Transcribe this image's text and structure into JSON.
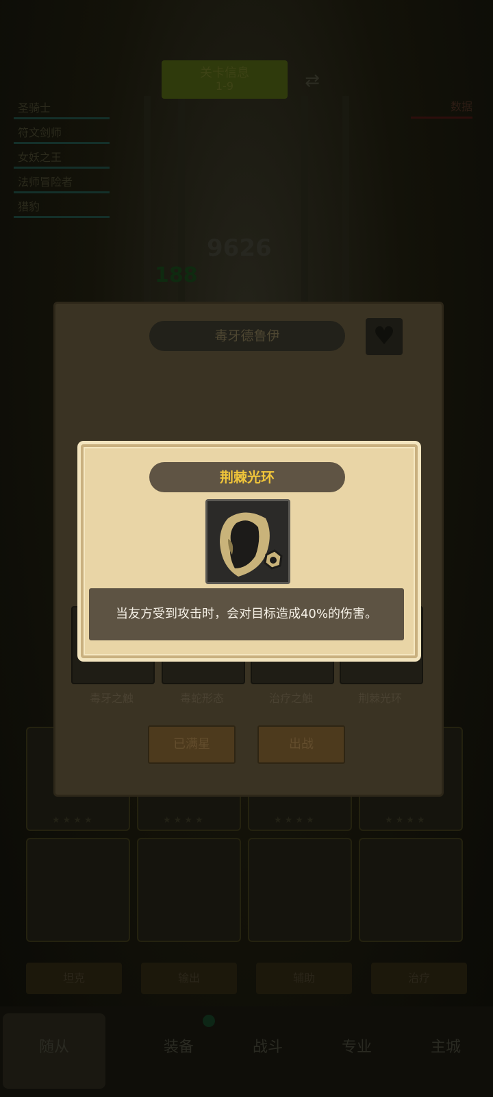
{
  "background": {
    "stage_banner": {
      "line1": "关卡信息",
      "line2": "1-9"
    },
    "hero_list": [
      "圣骑士",
      "符文剑师",
      "女妖之王",
      "法师冒险者",
      "猎豹"
    ],
    "data_button": "数据",
    "power_number": "9626",
    "green_number": "188",
    "role_buttons": [
      "坦克",
      "输出",
      "辅助",
      "治疗"
    ],
    "nav": [
      "随从",
      "装备",
      "战斗",
      "专业",
      "主城"
    ]
  },
  "hero_panel": {
    "title": "毒牙德鲁伊",
    "skills": [
      "毒牙之触",
      "毒蛇形态",
      "治疗之触",
      "荆棘光环"
    ],
    "buttons": {
      "max_star": "已满星",
      "deploy": "出战"
    }
  },
  "skill_popup": {
    "title": "荆棘光环",
    "description": "当友方受到攻击时，会对目标造成40%的伤害。"
  },
  "colors": {
    "popup_bg": "#e9d5a6",
    "title_text": "#f0c53a",
    "desc_bg": "#5d5343",
    "icon": "#c9b37a"
  },
  "icons": {
    "favorite": "heart-icon",
    "swap": "swap-icon",
    "skill": "thorn-aura-icon"
  }
}
